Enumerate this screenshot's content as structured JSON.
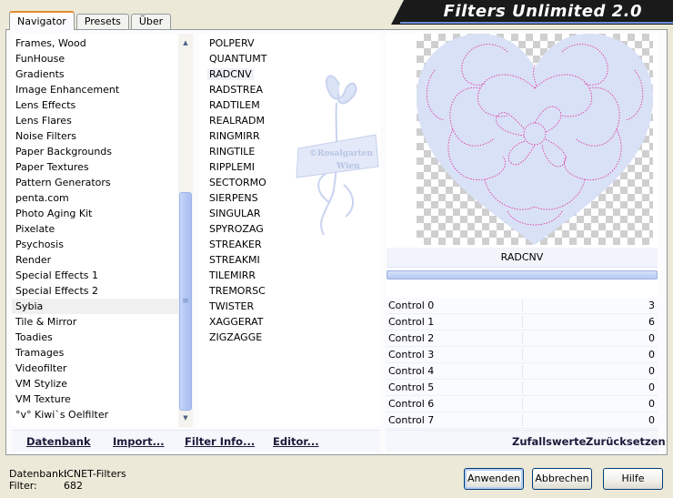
{
  "banner_title": "Filters Unlimited 2.0",
  "tabs": [
    {
      "label": "Navigator",
      "active": true
    },
    {
      "label": "Presets",
      "active": false
    },
    {
      "label": "Über",
      "active": false
    }
  ],
  "categories": [
    "Frames, Wood",
    "FunHouse",
    "Gradients",
    "Image Enhancement",
    "Lens Effects",
    "Lens Flares",
    "Noise Filters",
    "Paper Backgrounds",
    "Paper Textures",
    "Pattern Generators",
    "penta.com",
    "Photo Aging Kit",
    "Pixelate",
    "Psychosis",
    "Render",
    "Special Effects 1",
    "Special Effects 2",
    "Sybia",
    "Tile & Mirror",
    "Toadies",
    "Tramages",
    "Videofilter",
    "VM Stylize",
    "VM Texture",
    "°v° Kiwi`s Oelfilter"
  ],
  "selected_category": "Sybia",
  "filters": [
    "POLPERV",
    "QUANTUMT",
    "RADCNV",
    "RADSTREA",
    "RADTILEM",
    "REALRADM",
    "RINGMIRR",
    "RINGTILE",
    "RIPPLEMI",
    "SECTORMO",
    "SIERPENS",
    "SINGULAR",
    "SPYROZAG",
    "STREAKER",
    "STREAKMI",
    "TILEMIRR",
    "TREMORSC",
    "TWISTER",
    "XAGGERAT",
    "ZIGZAGGE"
  ],
  "selected_filter": "RADCNV",
  "watermark_text": {
    "line1": "©Rosalgarten",
    "line2": "Wien"
  },
  "preview_filter_name": "RADCNV",
  "controls": [
    {
      "label": "Control 0",
      "value": "3"
    },
    {
      "label": "Control 1",
      "value": "6"
    },
    {
      "label": "Control 2",
      "value": "0"
    },
    {
      "label": "Control 3",
      "value": "0"
    },
    {
      "label": "Control 4",
      "value": "0"
    },
    {
      "label": "Control 5",
      "value": "0"
    },
    {
      "label": "Control 6",
      "value": "0"
    },
    {
      "label": "Control 7",
      "value": "0"
    }
  ],
  "links": {
    "datenbank": "Datenbank",
    "import": "Import...",
    "filter_info": "Filter Info...",
    "editor": "Editor...",
    "zufallswerte": "Zufallswerte",
    "zuruecksetzen": "Zurücksetzen"
  },
  "footer": {
    "db_label": "Datenbank:",
    "db_value": "ICNET-Filters",
    "filter_label": "Filter:",
    "filter_value": "682"
  },
  "buttons": {
    "apply": "Anwenden",
    "cancel": "Abbrechen",
    "help": "Hilfe"
  },
  "scroll": {
    "up_icon": "arrow-up-icon",
    "down_icon": "arrow-down-icon"
  },
  "colors": {
    "banner_bg": "#1a1a1a",
    "selected_bg": "#f0f0f0",
    "preview_pink": "#e0399e",
    "preview_heart": "#d9e1f7"
  }
}
